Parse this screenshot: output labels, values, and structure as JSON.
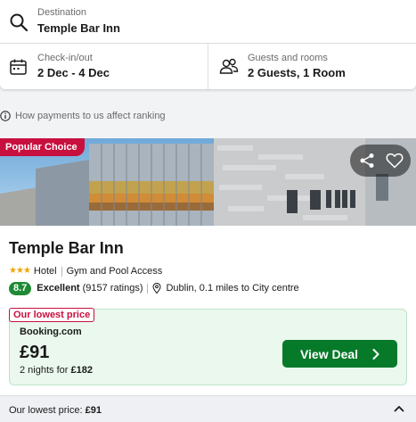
{
  "search": {
    "destination_label": "Destination",
    "destination_value": "Temple Bar Inn",
    "dates_label": "Check-in/out",
    "dates_value": "2 Dec - 4 Dec",
    "guests_label": "Guests and rooms",
    "guests_value": "2 Guests, 1 Room"
  },
  "ranking_note": "How payments to us affect ranking",
  "hotel": {
    "badge": "Popular Choice",
    "name": "Temple Bar Inn",
    "stars": 3,
    "type": "Hotel",
    "amenity": "Gym and Pool Access",
    "score": "8.7",
    "rating_word": "Excellent",
    "ratings_count": "(9157 ratings)",
    "location": "Dublin, 0.1 miles to City centre"
  },
  "deal": {
    "tag": "Our lowest price",
    "provider": "Booking.com",
    "price": "£91",
    "nights_text": "2 nights for",
    "total": "£182",
    "button_label": "View Deal"
  },
  "footer": {
    "label": "Our lowest price:",
    "price": "£91"
  },
  "colors": {
    "accent_red": "#c8103e",
    "deal_green": "#077a2a",
    "score_green": "#1f8a34",
    "star_gold": "#f0a500"
  },
  "icons": [
    "search-icon",
    "calendar-icon",
    "guests-icon",
    "info-icon",
    "share-icon",
    "heart-icon",
    "map-pin-icon",
    "chevron-right-icon",
    "chevron-up-icon"
  ]
}
